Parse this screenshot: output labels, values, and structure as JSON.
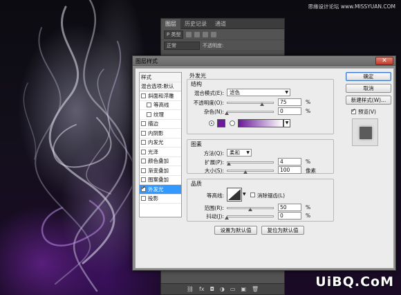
{
  "site_caption": "思缘设计论坛  www.MISSYUAN.COM",
  "watermark": "UiBQ.CoM",
  "layers_panel": {
    "tabs": [
      "图层",
      "历史记录",
      "通道"
    ],
    "filter_label": "P 类型",
    "blend_mode": "正常",
    "opacity_label": "不透明度:",
    "bottom_icons": [
      "⛓",
      "fx",
      "◘",
      "◑",
      "▭",
      "▣",
      "🗑"
    ]
  },
  "dialog": {
    "title": "图层样式",
    "close_symbol": "✕",
    "style_list": {
      "header": "样式",
      "blend_options": "混合选项:默认",
      "items": [
        {
          "label": "斜面和浮雕",
          "checked": false,
          "sub": false,
          "selected": false
        },
        {
          "label": "等高线",
          "checked": false,
          "sub": true,
          "selected": false
        },
        {
          "label": "纹理",
          "checked": false,
          "sub": true,
          "selected": false
        },
        {
          "label": "描边",
          "checked": false,
          "sub": false,
          "selected": false
        },
        {
          "label": "内阴影",
          "checked": false,
          "sub": false,
          "selected": false
        },
        {
          "label": "内发光",
          "checked": false,
          "sub": false,
          "selected": false
        },
        {
          "label": "光泽",
          "checked": false,
          "sub": false,
          "selected": false
        },
        {
          "label": "颜色叠加",
          "checked": false,
          "sub": false,
          "selected": false
        },
        {
          "label": "渐变叠加",
          "checked": false,
          "sub": false,
          "selected": false
        },
        {
          "label": "图案叠加",
          "checked": false,
          "sub": false,
          "selected": false
        },
        {
          "label": "外发光",
          "checked": true,
          "sub": false,
          "selected": true
        },
        {
          "label": "投影",
          "checked": false,
          "sub": false,
          "selected": false
        }
      ]
    },
    "outer_glow": {
      "section_title": "外发光",
      "structure": {
        "title": "结构",
        "blend_mode_label": "混合模式(E):",
        "blend_mode_value": "滤色",
        "opacity_label": "不透明度(O):",
        "opacity_value": "75",
        "opacity_fraction": 0.75,
        "noise_label": "杂色(N):",
        "noise_value": "0",
        "noise_fraction": 0.0,
        "unit": "%",
        "glow_color": "#6a1a9a",
        "gradient_start": "#6a1a9a",
        "gradient_end": "#ffffff"
      },
      "elements": {
        "title": "图素",
        "technique_label": "方法(Q):",
        "technique_value": "柔和",
        "spread_label": "扩展(P):",
        "spread_value": "4",
        "spread_fraction": 0.04,
        "size_label": "大小(S):",
        "size_value": "100",
        "size_fraction": 0.4,
        "size_unit": "像素"
      },
      "quality": {
        "title": "品质",
        "contour_label": "等高线:",
        "anti_alias_label": "消除锯齿(L)",
        "range_label": "范围(R):",
        "range_value": "50",
        "range_fraction": 0.5,
        "jitter_label": "抖动(J):",
        "jitter_value": "0",
        "jitter_fraction": 0.0
      },
      "make_default": "设置为默认值",
      "reset_default": "复位为默认值"
    },
    "buttons": {
      "ok": "确定",
      "cancel": "取消",
      "new_style": "新建样式(W)...",
      "preview_label": "预览(V)",
      "preview_checked": true
    }
  }
}
